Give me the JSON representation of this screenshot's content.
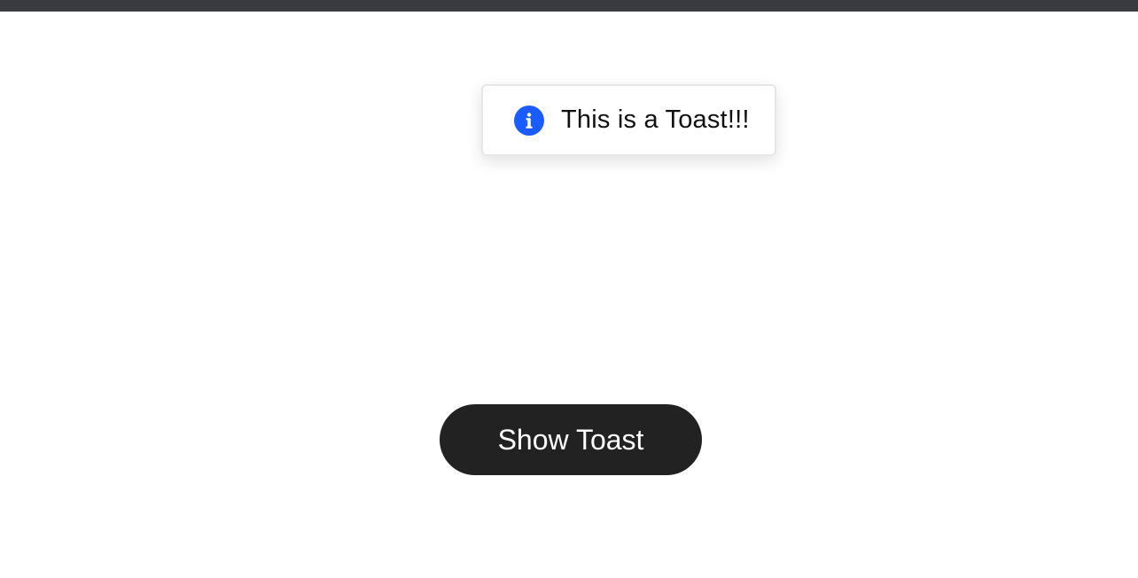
{
  "toast": {
    "icon": "info-icon",
    "message": "This is a Toast!!!"
  },
  "actions": {
    "show_toast_label": "Show Toast"
  },
  "colors": {
    "top_bar": "#3a3b40",
    "info_accent": "#1a5cff",
    "button_bg": "#222222",
    "button_text": "#ffffff",
    "page_bg": "#ffffff"
  }
}
